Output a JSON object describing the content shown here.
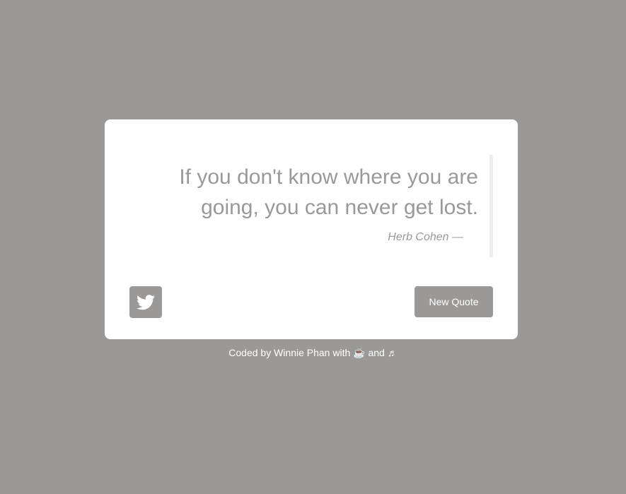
{
  "quote": {
    "text": "If you don't know where you are going, you can never get lost.",
    "author": "Herb Cohen —"
  },
  "buttons": {
    "tweet_icon": "twitter-icon",
    "new_quote": "New Quote"
  },
  "footer": {
    "prefix": "Coded by Winnie Phan with",
    "coffee": "☕",
    "and": "and",
    "music": "♬"
  },
  "colors": {
    "background": "#9b9997",
    "card": "#ffffff",
    "accent": "#9b9997"
  }
}
